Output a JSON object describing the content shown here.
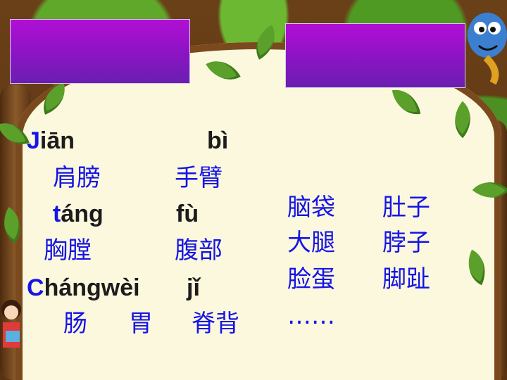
{
  "left_column": {
    "row1_pinyin_a_initial": "J",
    "row1_pinyin_a_rest": "iān",
    "row1_pinyin_b": "bì",
    "row1_chars_a": "肩膀",
    "row1_chars_b": "手臂",
    "row2_pinyin_a_initial": "t",
    "row2_pinyin_a_rest": "áng",
    "row2_pinyin_b": "fù",
    "row2_chars_a": "胸膛",
    "row2_chars_b": "腹部",
    "row3_pinyin_a_initial": "C",
    "row3_pinyin_a_rest": "hángwèi",
    "row3_pinyin_b": "jǐ",
    "row3_chars_a": "肠",
    "row3_chars_b": "胃",
    "row3_chars_c": "脊背"
  },
  "right_column": {
    "col1": [
      "脑袋",
      "大腿",
      "脸蛋",
      "……"
    ],
    "col2": [
      "肚子",
      "脖子",
      "脚趾"
    ]
  },
  "colors": {
    "text_blue": "#1515e6",
    "pinyin_black": "#1c1c1c",
    "box_purple": "#8a14c4",
    "board": "#fcf8de"
  }
}
